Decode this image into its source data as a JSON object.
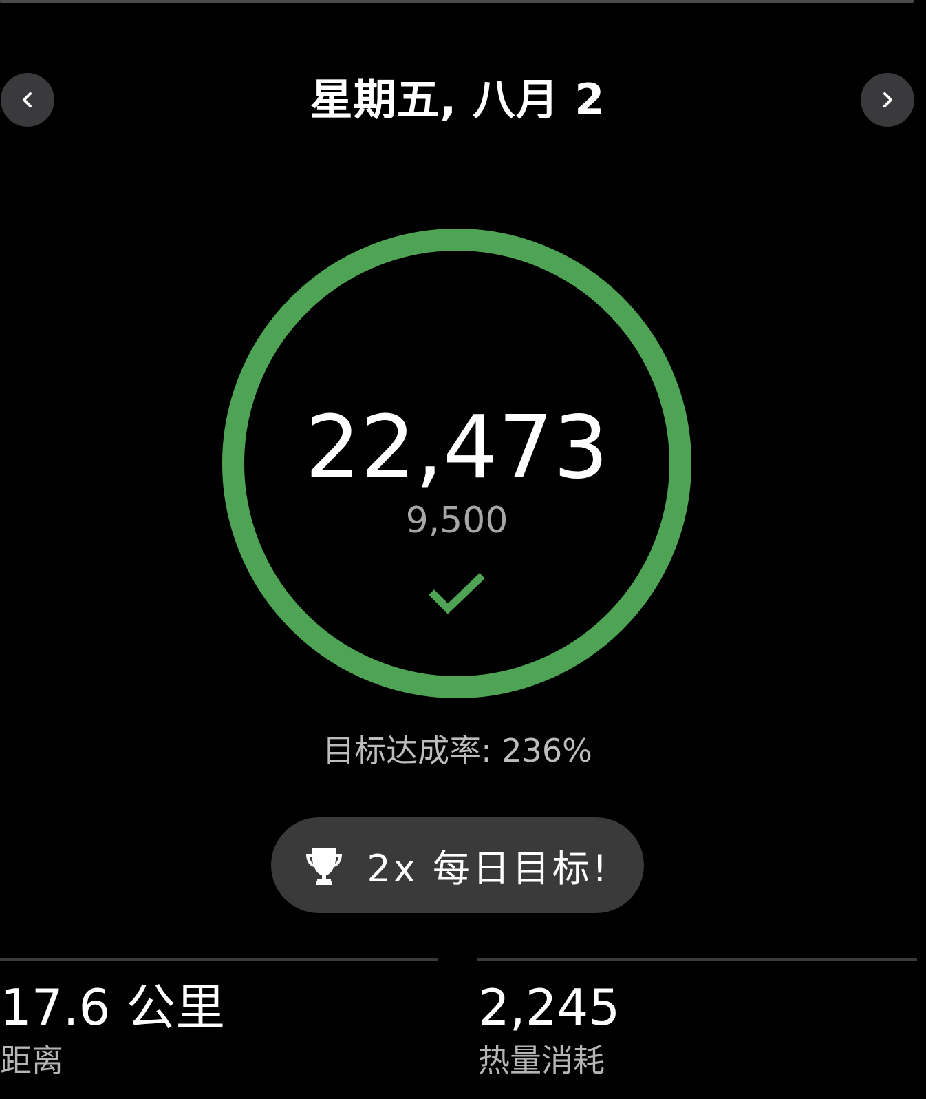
{
  "header": {
    "date_title": "星期五, 八月 2"
  },
  "steps": {
    "value": "22,473",
    "goal": "9,500",
    "progress_fraction": 1.0,
    "ring_color": "#4FA354"
  },
  "goal_rate": "目标达成率: 236%",
  "achievement": {
    "label": "2x 每日目标!",
    "icon": "trophy-icon"
  },
  "stats": {
    "distance": {
      "value": "17.6 公里",
      "label": "距离"
    },
    "calories": {
      "value": "2,245",
      "label": "热量消耗"
    }
  },
  "colors": {
    "background": "#000000",
    "accent_green": "#4FA354",
    "button_bg": "#3A3A3C"
  }
}
